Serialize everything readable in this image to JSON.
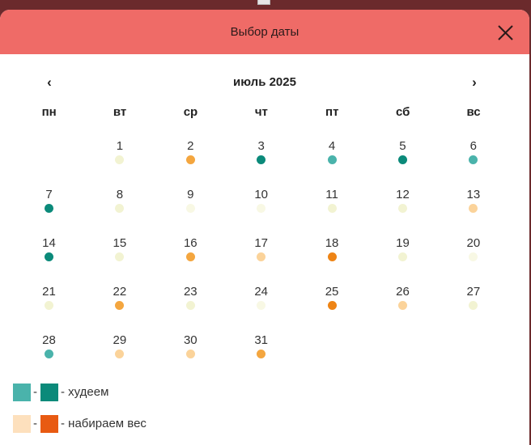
{
  "header": {
    "title": "Выбор даты"
  },
  "nav": {
    "prev": "‹",
    "next": "›",
    "month": "июль 2025"
  },
  "weekdays": [
    "пн",
    "вт",
    "ср",
    "чт",
    "пт",
    "сб",
    "вс"
  ],
  "status_colors": {
    "lose_strong": "#0b8a7a",
    "lose_light": "#4ab3ab",
    "neutral": "#f2f3d2",
    "neutral_pale": "#f8f8e4",
    "gain_light": "#fbd39a",
    "gain_mid": "#f4a63f",
    "gain_strong": "#ee8415"
  },
  "days": [
    {
      "day": "",
      "status": "",
      "empty": true
    },
    {
      "day": "1",
      "status": "neutral"
    },
    {
      "day": "2",
      "status": "gain_mid"
    },
    {
      "day": "3",
      "status": "lose_strong"
    },
    {
      "day": "4",
      "status": "lose_light"
    },
    {
      "day": "5",
      "status": "lose_strong"
    },
    {
      "day": "6",
      "status": "lose_light"
    },
    {
      "day": "7",
      "status": "lose_strong"
    },
    {
      "day": "8",
      "status": "neutral"
    },
    {
      "day": "9",
      "status": "neutral_pale"
    },
    {
      "day": "10",
      "status": "neutral_pale"
    },
    {
      "day": "11",
      "status": "neutral"
    },
    {
      "day": "12",
      "status": "neutral"
    },
    {
      "day": "13",
      "status": "gain_light"
    },
    {
      "day": "14",
      "status": "lose_strong"
    },
    {
      "day": "15",
      "status": "neutral"
    },
    {
      "day": "16",
      "status": "gain_mid"
    },
    {
      "day": "17",
      "status": "gain_light"
    },
    {
      "day": "18",
      "status": "gain_strong"
    },
    {
      "day": "19",
      "status": "neutral"
    },
    {
      "day": "20",
      "status": "neutral_pale"
    },
    {
      "day": "21",
      "status": "neutral"
    },
    {
      "day": "22",
      "status": "gain_mid"
    },
    {
      "day": "23",
      "status": "neutral"
    },
    {
      "day": "24",
      "status": "neutral_pale"
    },
    {
      "day": "25",
      "status": "gain_strong"
    },
    {
      "day": "26",
      "status": "gain_light"
    },
    {
      "day": "27",
      "status": "neutral"
    },
    {
      "day": "28",
      "status": "lose_light"
    },
    {
      "day": "29",
      "status": "gain_light"
    },
    {
      "day": "30",
      "status": "gain_light"
    },
    {
      "day": "31",
      "status": "gain_mid"
    }
  ],
  "legend": {
    "lose": {
      "dash": "-",
      "label": "- худеем",
      "color_light": "#4ab3ab",
      "color_strong": "#0b8a7a"
    },
    "gain": {
      "dash": "-",
      "label": "- набираем вес",
      "color_light": "#fde0bd",
      "color_strong": "#e85a12"
    }
  }
}
